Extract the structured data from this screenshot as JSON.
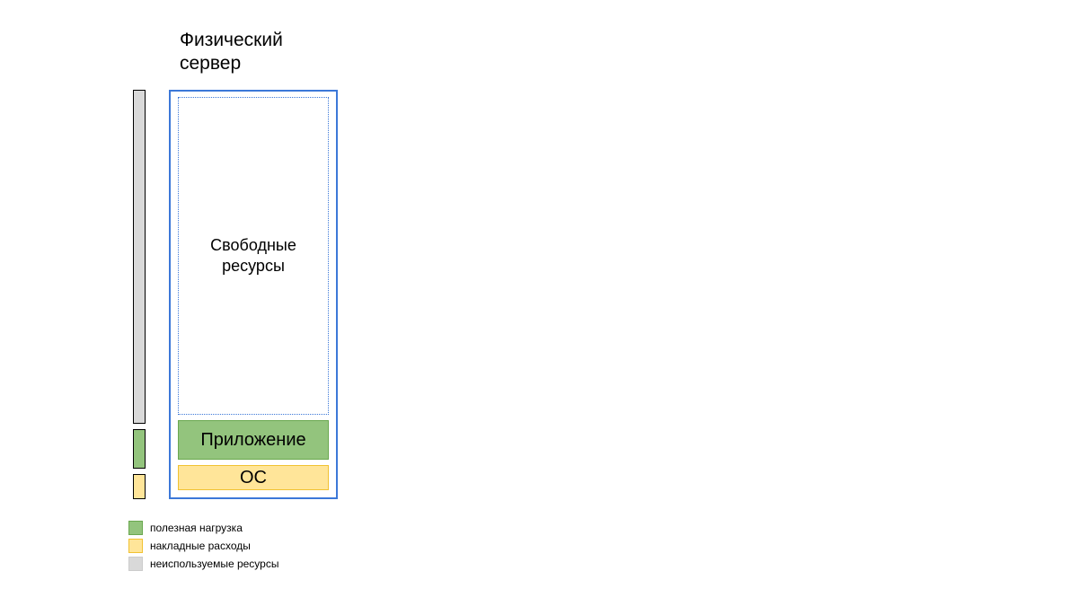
{
  "title_line1": "Физический",
  "title_line2": "сервер",
  "server": {
    "free_resources_label": "Свободные\nресурсы",
    "application_label": "Приложение",
    "os_label": "ОС"
  },
  "sidebar_order": [
    "unused",
    "gap",
    "green",
    "gap",
    "yellow"
  ],
  "legend": {
    "items": [
      {
        "swatch": "green",
        "label": "полезная нагрузка"
      },
      {
        "swatch": "yellow",
        "label": "накладные расходы"
      },
      {
        "swatch": "grey",
        "label": "неиспользуемые ресурсы"
      }
    ]
  },
  "colors": {
    "blue_border": "#3c78d8",
    "green_fill": "#93c47d",
    "green_border": "#6aa84f",
    "yellow_fill": "#ffe599",
    "yellow_border": "#f1c232",
    "grey_fill": "#d9d9d9",
    "grey_border": "#cccccc"
  }
}
